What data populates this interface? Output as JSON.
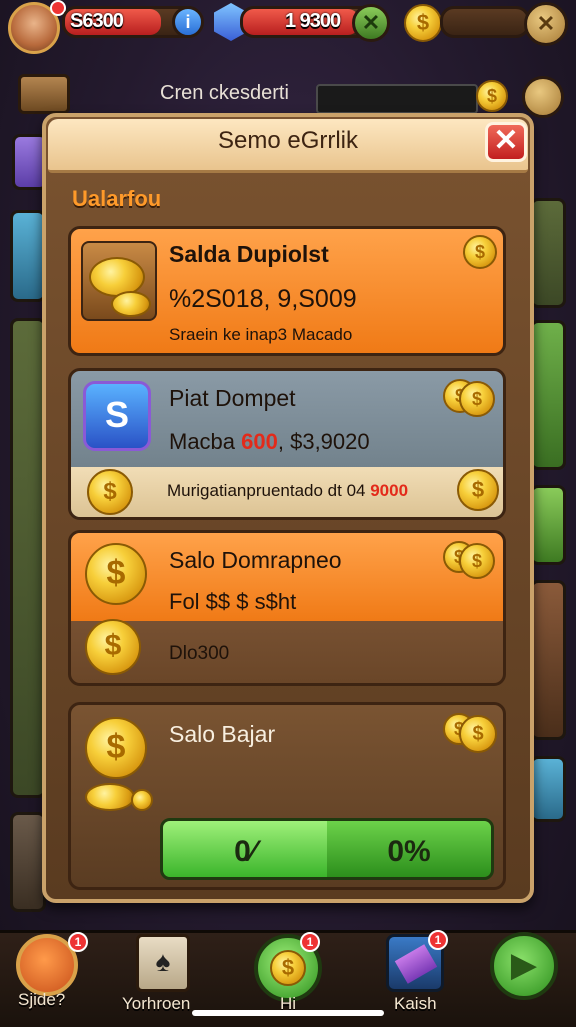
{
  "top_bar": {
    "balance_left": "S6300",
    "balance_mid": "1 9300",
    "info_icon": "i"
  },
  "sub_bar": {
    "text": "Cren ckesderti"
  },
  "modal": {
    "title": "Semo eGrrlik",
    "close_label": "✕",
    "section_label": "Ualarfou",
    "cards": [
      {
        "title": "Salda Dupiolst",
        "value": "%2S018, 9,S009",
        "sub": "Sraein ke inap3 Macado"
      },
      {
        "title": "Piat Dompet",
        "line_prefix": "Macba ",
        "line_red": "600",
        "line_suffix": ", $3,9020",
        "footer_prefix": "Murigatianpruentado dt 04 ",
        "footer_red": "9000"
      },
      {
        "title": "Salo Domrapneo",
        "line": "Fol $$ $ s$ht",
        "footer": "Dlo300"
      },
      {
        "title": "Salo Bajar"
      }
    ],
    "progress": {
      "left_label": "0⁄",
      "right_label": "0%"
    }
  },
  "bottom_nav": {
    "items": [
      {
        "label": "Sjide?",
        "badge": "1"
      },
      {
        "label": "Yorhroen",
        "badge": ""
      },
      {
        "label": "Hi",
        "badge": "1"
      },
      {
        "label": "Kaish",
        "badge": "1"
      },
      {
        "label": "",
        "badge": ""
      }
    ]
  },
  "colors": {
    "accent_orange": "#ff8a1f",
    "accent_green": "#4cc23a",
    "alert_red": "#e32a1a",
    "coin_gold": "#f7cf3a"
  }
}
